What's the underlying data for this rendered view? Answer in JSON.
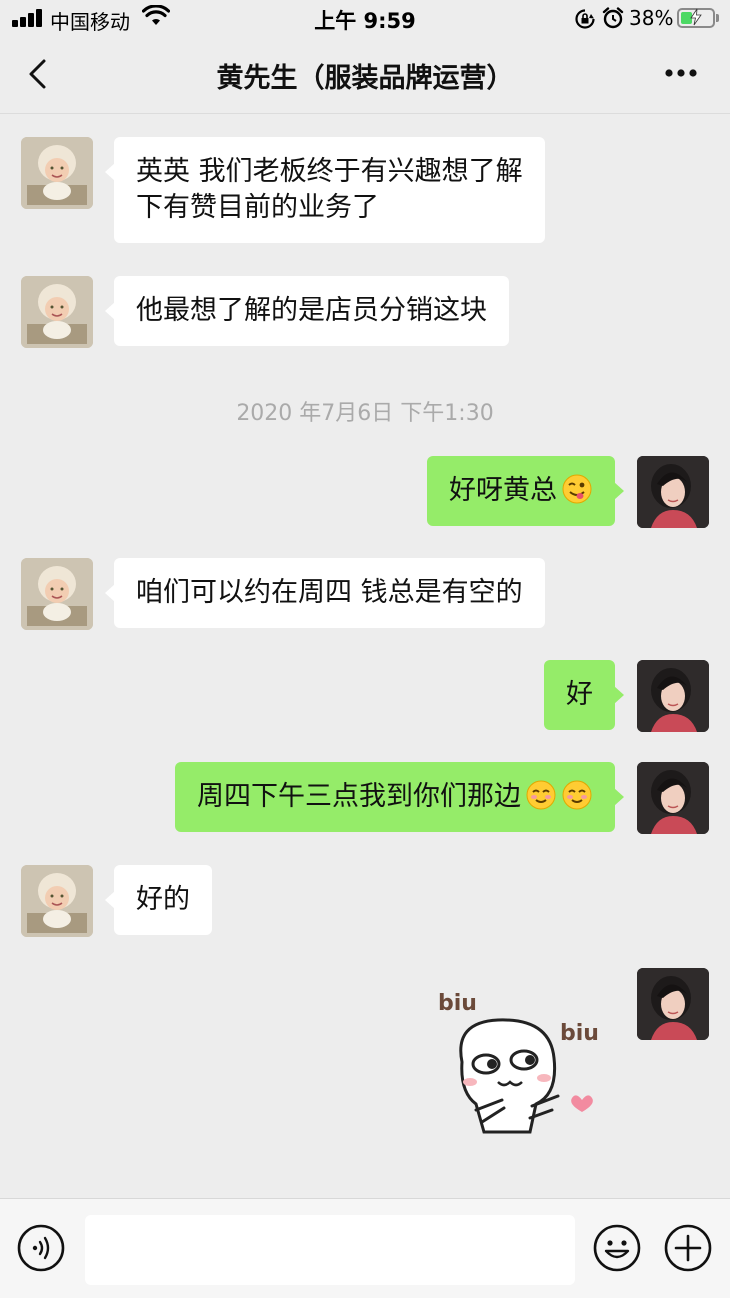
{
  "status_bar": {
    "carrier": "中国移动",
    "time": "上午 9:59",
    "battery_percent": "38%",
    "battery_level": 0.38,
    "icons": [
      "signal-icon",
      "wifi-icon",
      "orientation-lock-icon",
      "alarm-icon",
      "battery-icon"
    ]
  },
  "header": {
    "title": "黄先生（服装品牌运营）",
    "back_icon": "chevron-left-icon",
    "more_icon": "more-dots-icon"
  },
  "messages": [
    {
      "side": "left",
      "text_line1": "英英 我们老板终于有兴趣想了解",
      "text_line2": "下有赞目前的业务了"
    },
    {
      "side": "left",
      "text": "他最想了解的是店员分销这块"
    },
    {
      "type": "timestamp",
      "text": "2020 年7月6日 下午1:30"
    },
    {
      "side": "right",
      "text": "好呀黄总",
      "emoji": "winking-tongue-emoji"
    },
    {
      "side": "left",
      "text": "咱们可以约在周四 钱总是有空的"
    },
    {
      "side": "right",
      "text": "好"
    },
    {
      "side": "right",
      "text": "周四下午三点我到你们那边",
      "emoji": "smiling-blush-emoji x2"
    },
    {
      "side": "left",
      "text": "好的"
    },
    {
      "side": "right",
      "type": "sticker",
      "sticker_text_1": "biu",
      "sticker_text_2": "biu"
    }
  ],
  "input_bar": {
    "voice_icon": "voice-icon",
    "input_value": "",
    "emoji_icon": "emoji-icon",
    "plus_icon": "plus-icon"
  },
  "colors": {
    "background": "#ededed",
    "bubble_self": "#95ec69",
    "bubble_other": "#ffffff",
    "timestamp": "#aaaaaa"
  }
}
